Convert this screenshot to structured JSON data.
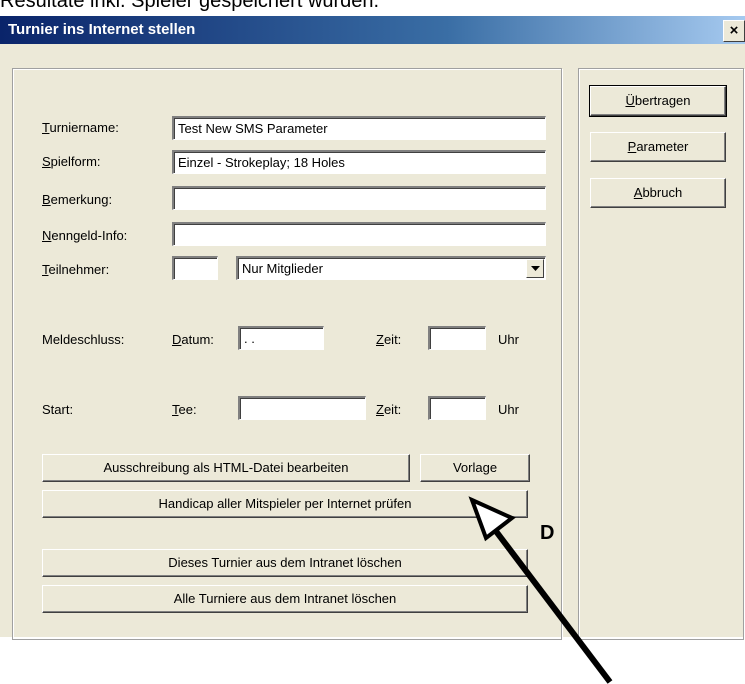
{
  "caption": {
    "text": "Resultate inkl. Spieler gespeichert wurden."
  },
  "window": {
    "title": "Turnier ins Internet stellen",
    "close_glyph": "×"
  },
  "form": {
    "turniername_label": "Turniername:",
    "turniername_value": "Test New SMS Parameter",
    "spielform_label": "Spielform:",
    "spielform_value": "Einzel - Strokeplay; 18 Holes",
    "bemerkung_label": "Bemerkung:",
    "bemerkung_value": "",
    "nenngeld_label": "Nenngeld-Info:",
    "nenngeld_value": "",
    "teilnehmer_label": "Teilnehmer:",
    "teilnehmer_count": "",
    "teilnehmer_selected": "Nur Mitglieder",
    "meldeschluss_label": "Meldeschluss:",
    "datum_label": "Datum:",
    "datum_value": " .  .",
    "zeit_label": "Zeit:",
    "meldeschluss_zeit_value": "",
    "uhr_label": "Uhr",
    "start_label": "Start:",
    "tee_label": "Tee:",
    "tee_value": "",
    "start_zeit_value": ""
  },
  "buttons": {
    "uebertragen": "Übertragen",
    "parameter": "Parameter",
    "abbruch": "Abbruch",
    "ausschreibung": "Ausschreibung als HTML-Datei bearbeiten",
    "vorlage": "Vorlage",
    "handicap": "Handicap aller Mitspieler per Internet prüfen",
    "turnier_loeschen": "Dieses Turnier aus dem Intranet löschen",
    "alle_loeschen": "Alle Turniere aus dem Intranet löschen"
  },
  "annotation": {
    "letter": "D"
  }
}
